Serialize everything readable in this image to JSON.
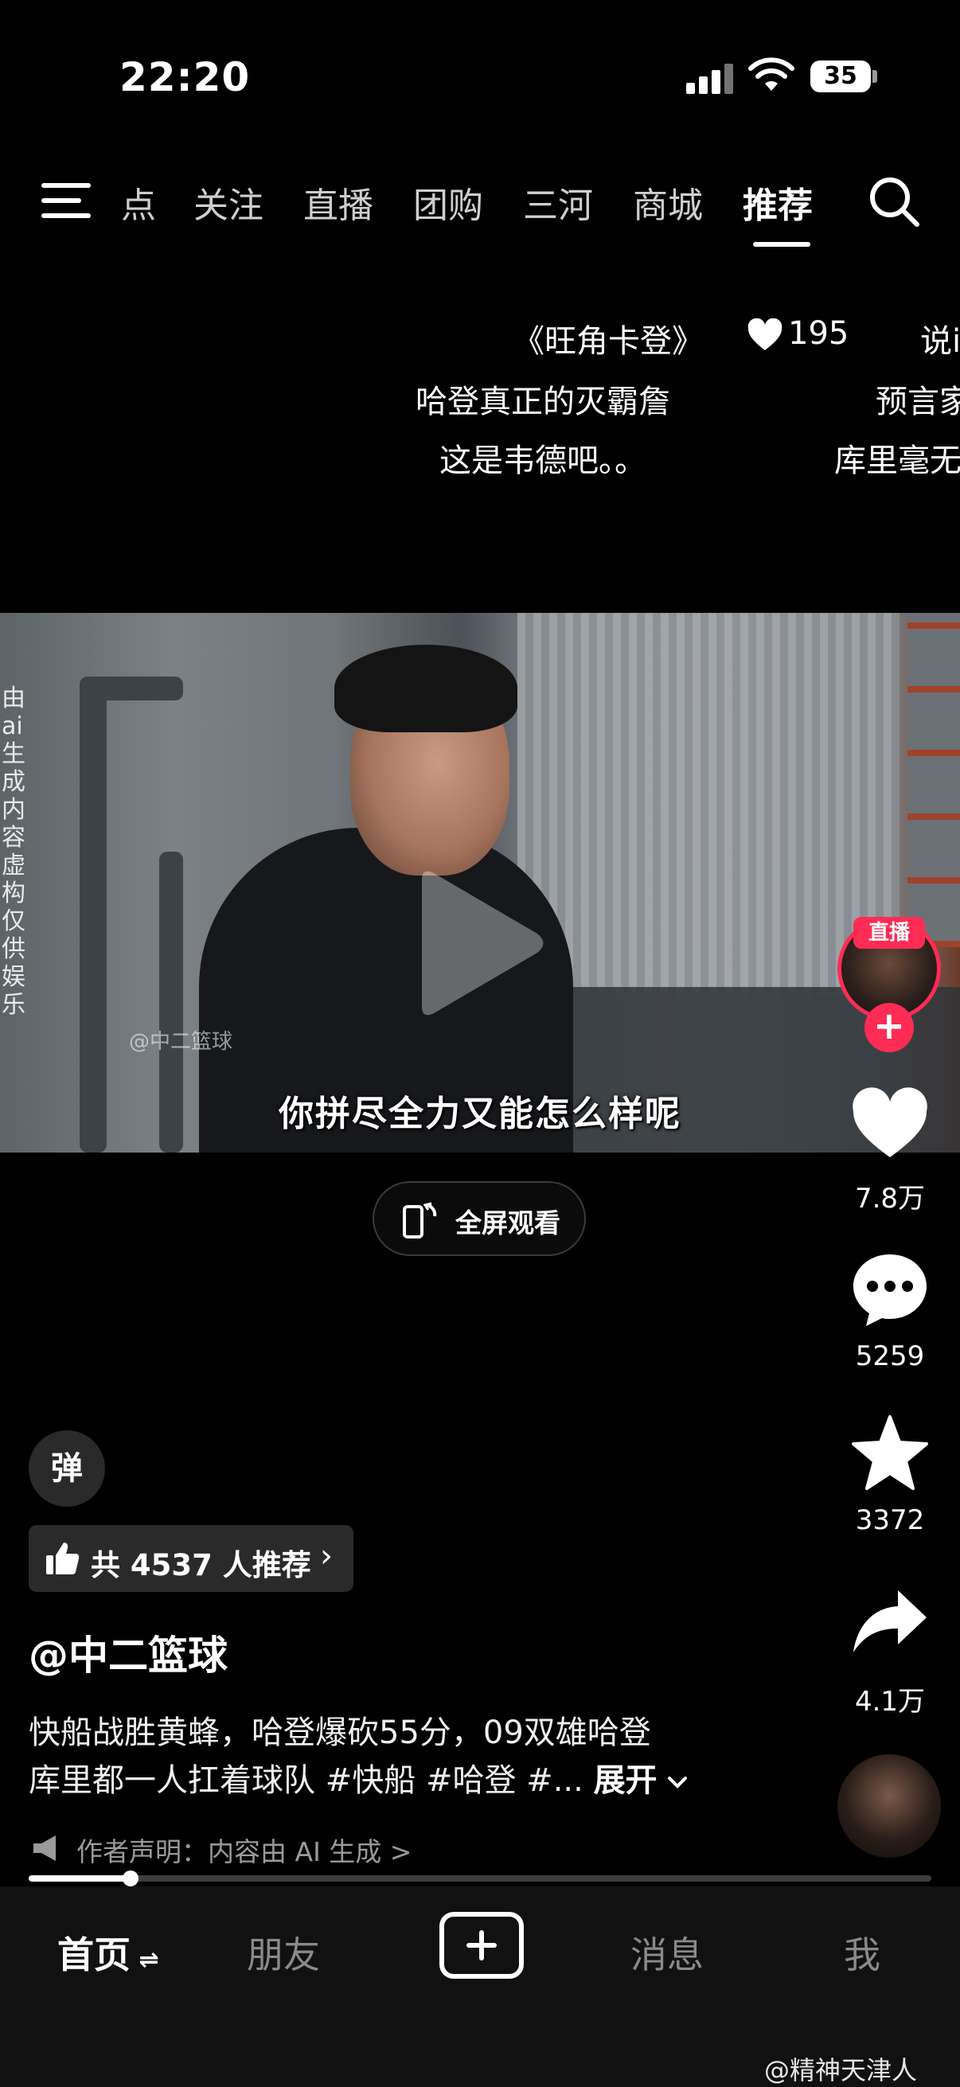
{
  "status_bar": {
    "time": "22:20",
    "battery": "35"
  },
  "top_nav": {
    "tabs": [
      "点",
      "关注",
      "直播",
      "团购",
      "三河",
      "商城",
      "推荐"
    ],
    "active_tab": "推荐"
  },
  "danmaku": {
    "line1_title": "《旺角卡登》",
    "line1_likes": "195",
    "line1_right": "说i",
    "line2_left": "哈登真正的灭霸詹",
    "line2_right": "预言家",
    "line3_left": "这是韦德吧。。",
    "line3_right": "库里毫无"
  },
  "video": {
    "ai_notice": "由ai生成 内容虚构 仅供娱乐",
    "watermark": "@中二篮球",
    "subtitle": "你拼尽全力又能怎么样呢"
  },
  "fullscreen_button": {
    "label": "全屏观看"
  },
  "actions": {
    "live_badge": "直播",
    "likes": "7.8万",
    "comments": "5259",
    "favorites": "3372",
    "shares": "4.1万"
  },
  "info": {
    "danmu_toggle": "弹",
    "recommend_text": "共 4537 人推荐",
    "author": "@中二篮球",
    "desc_line1": "快船战胜黄蜂，哈登爆砍55分，09双雄哈登",
    "desc_line2": "库里都一人扛着球队 #快船 #哈登 #...",
    "expand": "展开",
    "declaration": "作者声明：内容由 AI 生成 >"
  },
  "progress": {
    "fraction": 0.113
  },
  "bottom_tabs": {
    "home": "首页",
    "friends": "朋友",
    "messages": "消息",
    "me": "我"
  },
  "corner_watermark": "@精神天津人",
  "colors": {
    "accent": "#fe2c55",
    "background": "#000000"
  }
}
